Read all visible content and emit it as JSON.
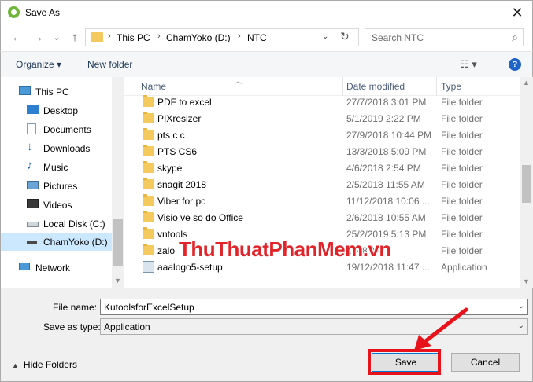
{
  "window": {
    "title": "Save As",
    "close_glyph": "✕"
  },
  "nav": {
    "back_glyph": "←",
    "forward_glyph": "→",
    "recent_glyph": "⌄",
    "up_glyph": "↑",
    "breadcrumbs": [
      "This PC",
      "ChamYoko (D:)",
      "NTC"
    ],
    "separator": "›",
    "search_placeholder": "Search NTC"
  },
  "toolbar": {
    "organize_label": "Organize ▾",
    "new_folder_label": "New folder",
    "views_glyph": "☷ ▾",
    "help_glyph": "?"
  },
  "sidebar": {
    "items": [
      {
        "label": "This PC",
        "icon": "pc-icon"
      },
      {
        "label": "Desktop",
        "icon": "desktop-icon"
      },
      {
        "label": "Documents",
        "icon": "documents-icon"
      },
      {
        "label": "Downloads",
        "icon": "downloads-icon"
      },
      {
        "label": "Music",
        "icon": "music-icon"
      },
      {
        "label": "Pictures",
        "icon": "pictures-icon"
      },
      {
        "label": "Videos",
        "icon": "videos-icon"
      },
      {
        "label": "Local Disk (C:)",
        "icon": "drive-icon"
      },
      {
        "label": "ChamYoko (D:)",
        "icon": "drive-icon",
        "selected": true
      },
      {
        "label": "Network",
        "icon": "network-icon"
      }
    ]
  },
  "files": {
    "columns": {
      "name": "Name",
      "date": "Date modified",
      "type": "Type"
    },
    "rows": [
      {
        "name": "PDF to excel",
        "date": "27/7/2018 3:01 PM",
        "type": "File folder",
        "kind": "folder"
      },
      {
        "name": "PIXresizer",
        "date": "5/1/2019 2:22 PM",
        "type": "File folder",
        "kind": "folder"
      },
      {
        "name": "pts c c",
        "date": "27/9/2018 10:44 PM",
        "type": "File folder",
        "kind": "folder"
      },
      {
        "name": "PTS CS6",
        "date": "13/3/2018 5:09 PM",
        "type": "File folder",
        "kind": "folder"
      },
      {
        "name": "skype",
        "date": "4/6/2018 2:54 PM",
        "type": "File folder",
        "kind": "folder"
      },
      {
        "name": "snagit 2018",
        "date": "2/5/2018 11:55 AM",
        "type": "File folder",
        "kind": "folder"
      },
      {
        "name": "Viber for pc",
        "date": "11/12/2018 10:06 ...",
        "type": "File folder",
        "kind": "folder"
      },
      {
        "name": "Visio ve so do Office",
        "date": "2/6/2018 10:55 AM",
        "type": "File folder",
        "kind": "folder"
      },
      {
        "name": "vntools",
        "date": "25/2/2019 5:13 PM",
        "type": "File folder",
        "kind": "folder"
      },
      {
        "name": "zalo",
        "date": "...:48 AM",
        "type": "File folder",
        "kind": "folder"
      },
      {
        "name": "aaalogo5-setup",
        "date": "19/12/2018 11:47 ...",
        "type": "Application",
        "kind": "app"
      }
    ]
  },
  "watermark": "ThuThuatPhanMem.vn",
  "form": {
    "file_name_label": "File name:",
    "file_name_value": "KutoolsforExcelSetup",
    "save_type_label": "Save as type:",
    "save_type_value": "Application",
    "dropdown_glyph": "⌄"
  },
  "footer": {
    "hide_folders_label": "Hide Folders",
    "hide_glyph": "▲",
    "save_label": "Save",
    "cancel_label": "Cancel"
  },
  "colors": {
    "highlight": "#e8121b",
    "watermark": "#e0242a",
    "accent": "#0078d7"
  }
}
